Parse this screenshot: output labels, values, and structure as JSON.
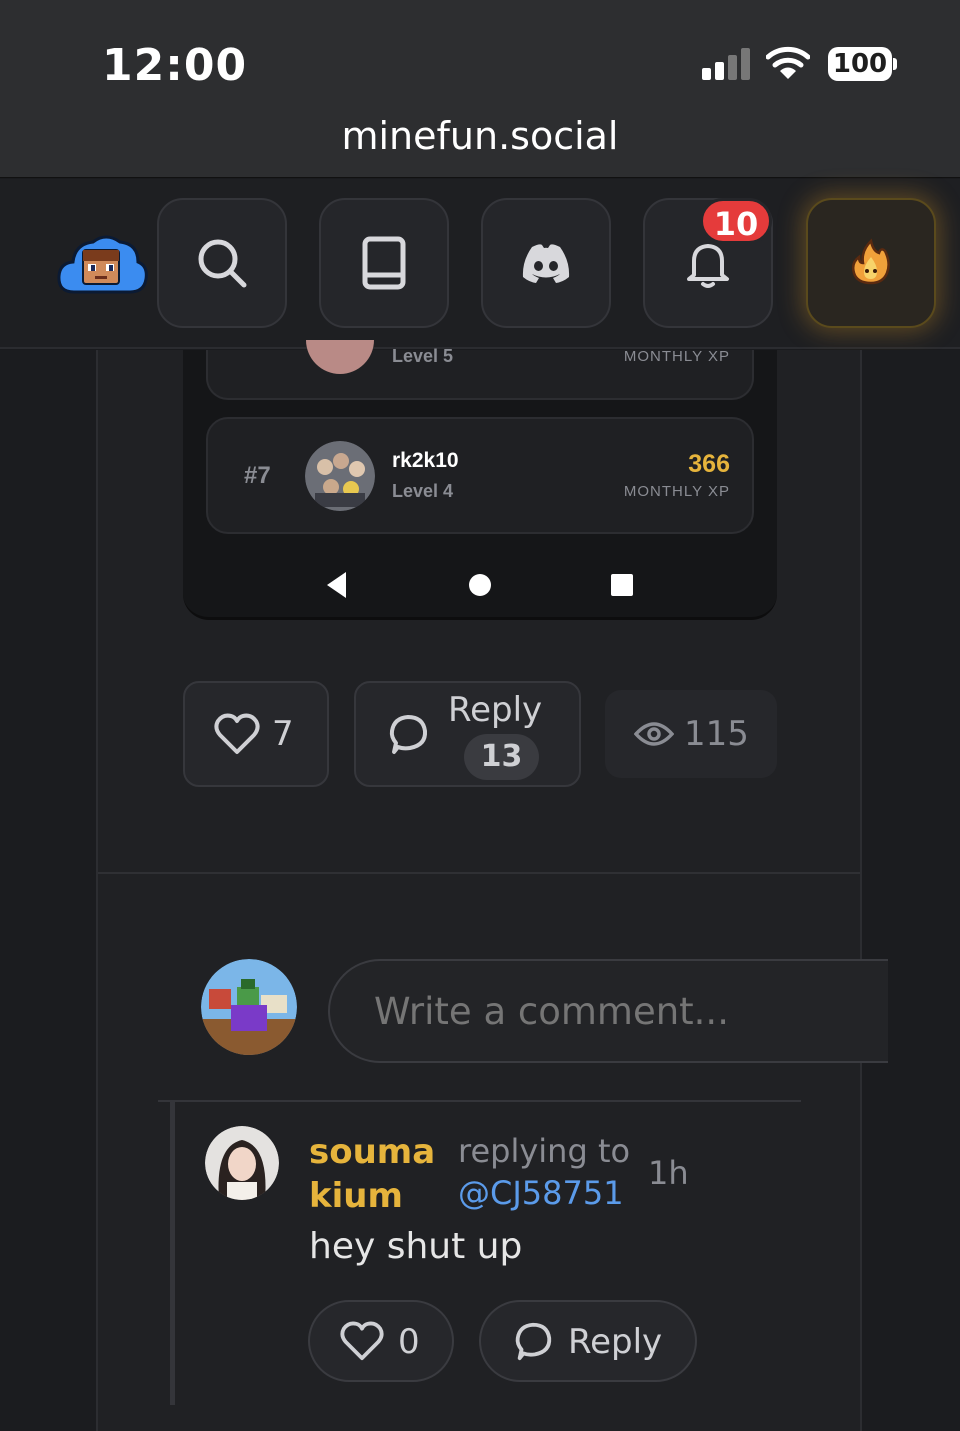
{
  "status_bar": {
    "time": "12:00",
    "battery": "100"
  },
  "browser": {
    "url": "minefun.social"
  },
  "nav": {
    "notification_count": "10",
    "icons": [
      "cloud-avatar-logo",
      "search-icon",
      "book-icon",
      "discord-icon",
      "bell-icon",
      "fire-icon"
    ]
  },
  "leaderboard": {
    "partial_row": {
      "level": "Level 5",
      "xp_label": "MONTHLY XP"
    },
    "row": {
      "rank": "#7",
      "name": "rk2k10",
      "level": "Level 4",
      "xp": "366",
      "xp_label": "MONTHLY XP"
    }
  },
  "post_actions": {
    "likes": "7",
    "reply_label": "Reply",
    "reply_count": "13",
    "views": "115"
  },
  "comment_box": {
    "placeholder": "Write a comment..."
  },
  "comment": {
    "author_line1": "souma",
    "author_line2": "kium",
    "replying_to": "replying to",
    "mention": "@CJ58751",
    "time": "1h",
    "body": "hey shut up",
    "likes": "0",
    "reply_label": "Reply"
  },
  "colors": {
    "accent_gold": "#e6b43c",
    "mention_blue": "#5b9bea",
    "badge_red": "#e53b3b",
    "background": "#1a1b1e"
  }
}
